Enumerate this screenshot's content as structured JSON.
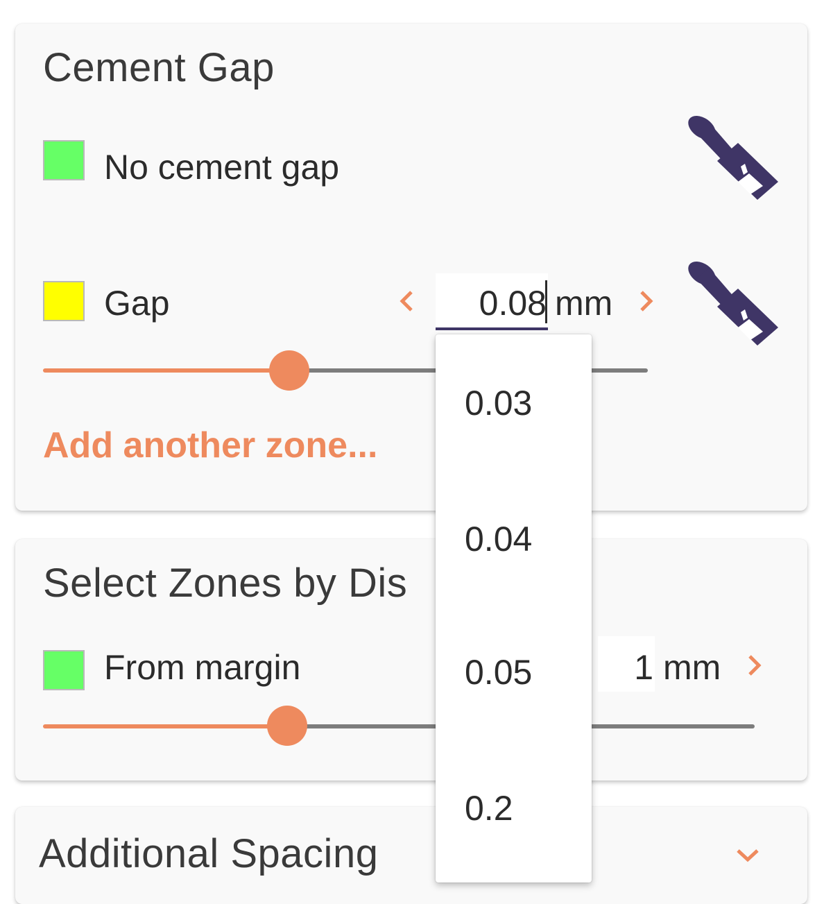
{
  "cement_gap": {
    "title": "Cement Gap",
    "zones": [
      {
        "label": "No cement gap",
        "swatch_color": "#66ff66"
      },
      {
        "label": "Gap",
        "swatch_color": "#ffff00",
        "value": "0.08",
        "unit": "mm",
        "slider_fraction": 0.4
      }
    ],
    "add_zone_label": "Add another zone..."
  },
  "gap_dropdown": {
    "options": [
      "0.03",
      "0.04",
      "0.05",
      "0.2"
    ]
  },
  "select_zones": {
    "title": "Select Zones by Dis",
    "row": {
      "label": "From margin",
      "swatch_color": "#66ff66",
      "value": "1",
      "unit": "mm",
      "slider_fraction": 0.34
    }
  },
  "additional_spacing": {
    "title": "Additional Spacing"
  },
  "colors": {
    "accent": "#ee8a5e",
    "brush": "#3f3566",
    "track": "#7d7d7d"
  },
  "icons": {
    "paint_brush": "paint-brush-icon",
    "chevron_left": "chevron-left-icon",
    "chevron_right": "chevron-right-icon",
    "chevron_down": "chevron-down-icon"
  }
}
